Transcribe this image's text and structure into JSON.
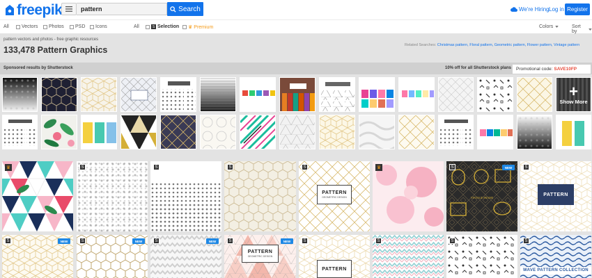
{
  "header": {
    "logo_text": "freepik",
    "search_value": "pattern",
    "search_button": "Search",
    "hiring_link": "We're Hiring",
    "login_link": "Log in",
    "register_button": "Register"
  },
  "filters": {
    "type_all": "All",
    "vectors": "Vectors",
    "photos": "Photos",
    "psd": "PSD",
    "icons": "Icons",
    "license_all": "All",
    "selection": "Selection",
    "premium": "Premium",
    "colors": "Colors",
    "sort": "Sort by"
  },
  "page": {
    "subtitle": "pattern vectors and photos - free graphic resources",
    "title": "133,478 Pattern Graphics",
    "related_label": "Related Searches:",
    "related_links": "Christmas pattern, Floral pattern, Geometric pattern, Flower pattern, Vintage pattern"
  },
  "sponsored": {
    "label": "Sponsored results by Shutterstock",
    "discount": "10% off for all Shutterstock plans",
    "promo_label": "Promotional code:",
    "promo_code": "SAVE10FP",
    "show_more": "Show More"
  },
  "results": {
    "badge_new": "NEW",
    "card_pattern": "PATTERN",
    "card_geometric": "GEOMETRIC DESIGN",
    "card_vintage": "VINTAGE FRAME",
    "card_wave": "WAVE PATTERN COLLECTION"
  },
  "colors": {
    "accent": "#1273eb",
    "premium": "#f49b1a",
    "new_badge": "#1e88e5",
    "promo_code": "#e74c3c"
  }
}
